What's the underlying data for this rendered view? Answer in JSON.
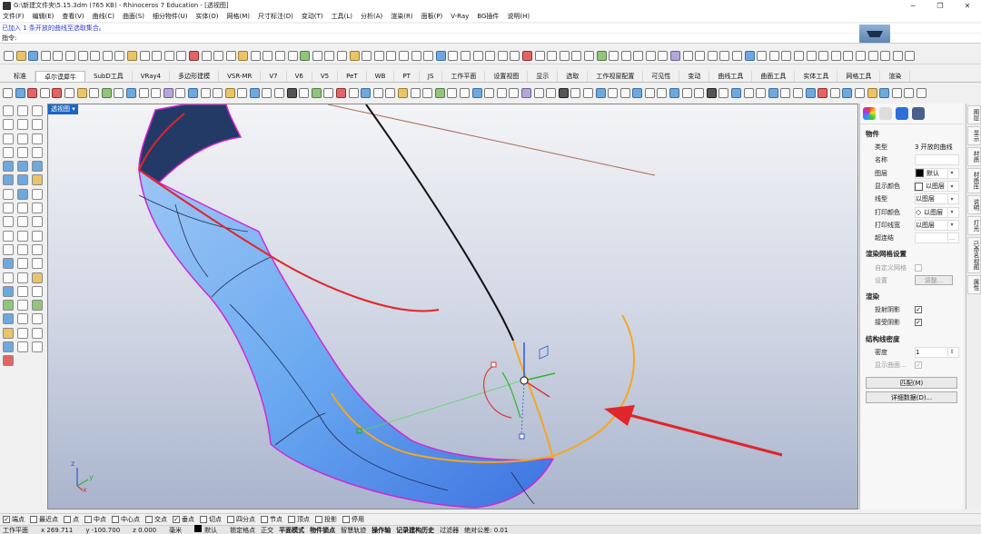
{
  "window": {
    "title": "G:\\新建文件夹\\5.15.3dm (765 KB) - Rhinoceros 7 Education - [透视图]",
    "minimize": "─",
    "maximize": "❐",
    "close": "✕"
  },
  "menu": [
    "文件(F)",
    "编辑(E)",
    "查看(V)",
    "曲线(C)",
    "曲面(S)",
    "细分物件(U)",
    "实体(O)",
    "网格(M)",
    "尺寸标注(D)",
    "变动(T)",
    "工具(L)",
    "分析(A)",
    "渲染(R)",
    "面板(P)",
    "V-Ray",
    "BG插件",
    "说明(H)"
  ],
  "command": {
    "history": "已加入 1 条开放的曲线至选取集合。",
    "prompt": "指令:"
  },
  "tabs": [
    "标准",
    "卓尔谟犀牛",
    "SubD工具",
    "VRay4",
    "多边形建模",
    "VSR-MR",
    "V7",
    "V6",
    "V5",
    "PeT",
    "WB",
    "PT",
    "JS",
    "工作平面",
    "设置视图",
    "显示",
    "选取",
    "工作视窗配置",
    "可见性",
    "变动",
    "曲线工具",
    "曲面工具",
    "实体工具",
    "网格工具",
    "渲染"
  ],
  "active_tab_index": 1,
  "viewport": {
    "label": "透视图 ▾",
    "axis_x": "x",
    "axis_y": "y",
    "axis_z": "z"
  },
  "properties": {
    "section_object": "物件",
    "type_label": "类型",
    "type_value": "3 开放的曲线",
    "name_label": "名称",
    "name_value": "",
    "layer_label": "图层",
    "layer_value": "默认",
    "display_color_label": "显示颜色",
    "display_color_value": "以图层",
    "linetype_label": "线型",
    "linetype_value": "以图层",
    "print_color_label": "打印颜色",
    "print_color_value": "以图层",
    "print_width_label": "打印线宽",
    "print_width_value": "以图层",
    "hyperlink_label": "超连结",
    "hyperlink_value": "",
    "section_render_mesh": "渲染网格设置",
    "custom_mesh_label": "自定义网格",
    "settings_label": "设置",
    "adjust_button": "调整...",
    "section_render": "渲染",
    "cast_shadow_label": "投射阴影",
    "cast_shadow_check": "✓",
    "receive_shadow_label": "接受阴影",
    "receive_shadow_check": "✓",
    "section_isocurve": "结构线密度",
    "density_label": "密度",
    "density_value": "1",
    "show_surface_label": "显示曲面...",
    "show_surface_check": "✓",
    "match_button": "匹配(M)",
    "details_button": "详细数据(D)..."
  },
  "side_tabs": [
    "图层",
    "显示",
    "材质",
    "材质库",
    "说明",
    "灯光",
    "已命名视图",
    "属性"
  ],
  "osnap": [
    {
      "label": "端点",
      "checked": true
    },
    {
      "label": "最近点",
      "checked": false
    },
    {
      "label": "点",
      "checked": false
    },
    {
      "label": "中点",
      "checked": false
    },
    {
      "label": "中心点",
      "checked": false
    },
    {
      "label": "交点",
      "checked": false
    },
    {
      "label": "垂点",
      "checked": true
    },
    {
      "label": "切点",
      "checked": false
    },
    {
      "label": "四分点",
      "checked": false
    },
    {
      "label": "节点",
      "checked": false
    },
    {
      "label": "顶点",
      "checked": false
    },
    {
      "label": "投影",
      "checked": false
    },
    {
      "label": "停用",
      "checked": false
    }
  ],
  "status": {
    "cplane": "工作平面",
    "x": "x 269.711",
    "y": "y -100.700",
    "z": "z 0.000",
    "units": "毫米",
    "layer": "默认",
    "lock_grid": "锁定格点",
    "ortho": "正交",
    "planar": "平面模式",
    "osnap": "物件锁点",
    "smarttrack": "智慧轨迹",
    "gumball": "操作轴",
    "history": "记录建构历史",
    "filter": "过滤器",
    "tolerance": "绝对公差: 0.01"
  },
  "colors": {
    "viewport_label_bg": "#1a64c8",
    "surface_blue": "#6aa9f0",
    "curve_red": "#e4232b",
    "curve_orange": "#f5a623",
    "edge_magenta": "#cf27d6",
    "arrow_red": "#e0262b"
  }
}
